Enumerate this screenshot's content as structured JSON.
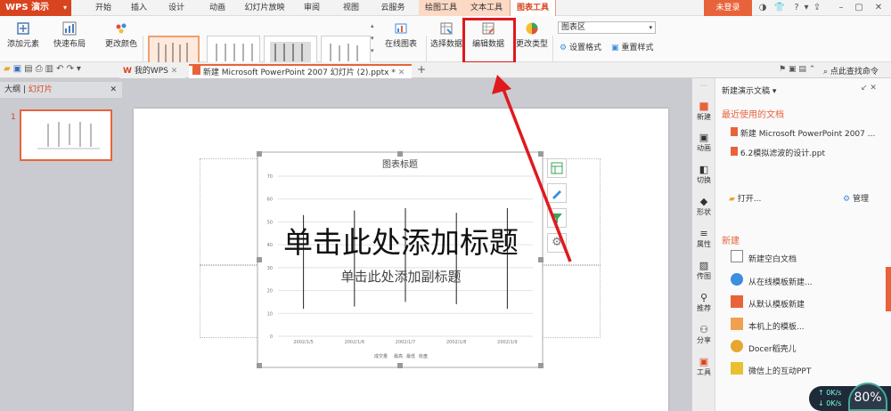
{
  "app": {
    "logo": "WPS 演示",
    "logo_dropdown": "▾"
  },
  "tabs": [
    "开始",
    "插入",
    "设计",
    "动画",
    "幻灯片放映",
    "审阅",
    "视图",
    "云服务"
  ],
  "context_tabs": [
    "绘图工具",
    "文本工具",
    "图表工具"
  ],
  "login": "未登录",
  "ribbon": {
    "add_element": "添加元素",
    "quick_layout": "快速布局",
    "change_color": "更改颜色",
    "online_chart": "在线图表",
    "select_data": "选择数据",
    "edit_data": "编辑数据",
    "change_type": "更改类型",
    "chart_area_select": "图表区",
    "set_format": "设置格式",
    "reset_style": "重置样式"
  },
  "doc_tabs": {
    "mywps": "我的WPS",
    "current": "新建 Microsoft PowerPoint 2007 幻灯片 (2).pptx *",
    "add": "+"
  },
  "search": "点此查找命令",
  "left_pane": {
    "outline": "大纲",
    "slides": "幻灯片",
    "slide_number": "1"
  },
  "slide": {
    "title_placeholder": "单击此处添加标题",
    "subtitle_placeholder": "单击此处添加副标题"
  },
  "chart_data": {
    "type": "bar",
    "title": "图表标题",
    "categories": [
      "2002/1/5",
      "2002/1/6",
      "2002/1/7",
      "2002/1/8",
      "2002/1/9"
    ],
    "ylim": [
      0,
      70
    ],
    "yticks": [
      0,
      10,
      20,
      30,
      40,
      50,
      60,
      70
    ],
    "legend": [
      "成交量",
      "最高",
      "最低",
      "收盘"
    ],
    "grid": true,
    "legend_position": "bottom"
  },
  "right_toolbar": [
    "新建",
    "动画",
    "切换",
    "形状",
    "属性",
    "传图",
    "推荐",
    "分享",
    "工具"
  ],
  "right_panel": {
    "header": "新建演示文稿",
    "recent_title": "最近使用的文档",
    "recent": [
      "新建 Microsoft PowerPoint 2007 ...",
      "6.2模拟滤波的设计.ppt"
    ],
    "open": "打开...",
    "manage": "管理",
    "new_title": "新建",
    "new_items": [
      "新建空白文档",
      "从在线模板新建...",
      "从默认模板新建",
      "本机上的模板...",
      "Docer稻壳儿",
      "微信上的互动PPT"
    ]
  },
  "status": {
    "speed_up": "0K/s",
    "speed_down": "0K/s",
    "percent": "80%"
  }
}
